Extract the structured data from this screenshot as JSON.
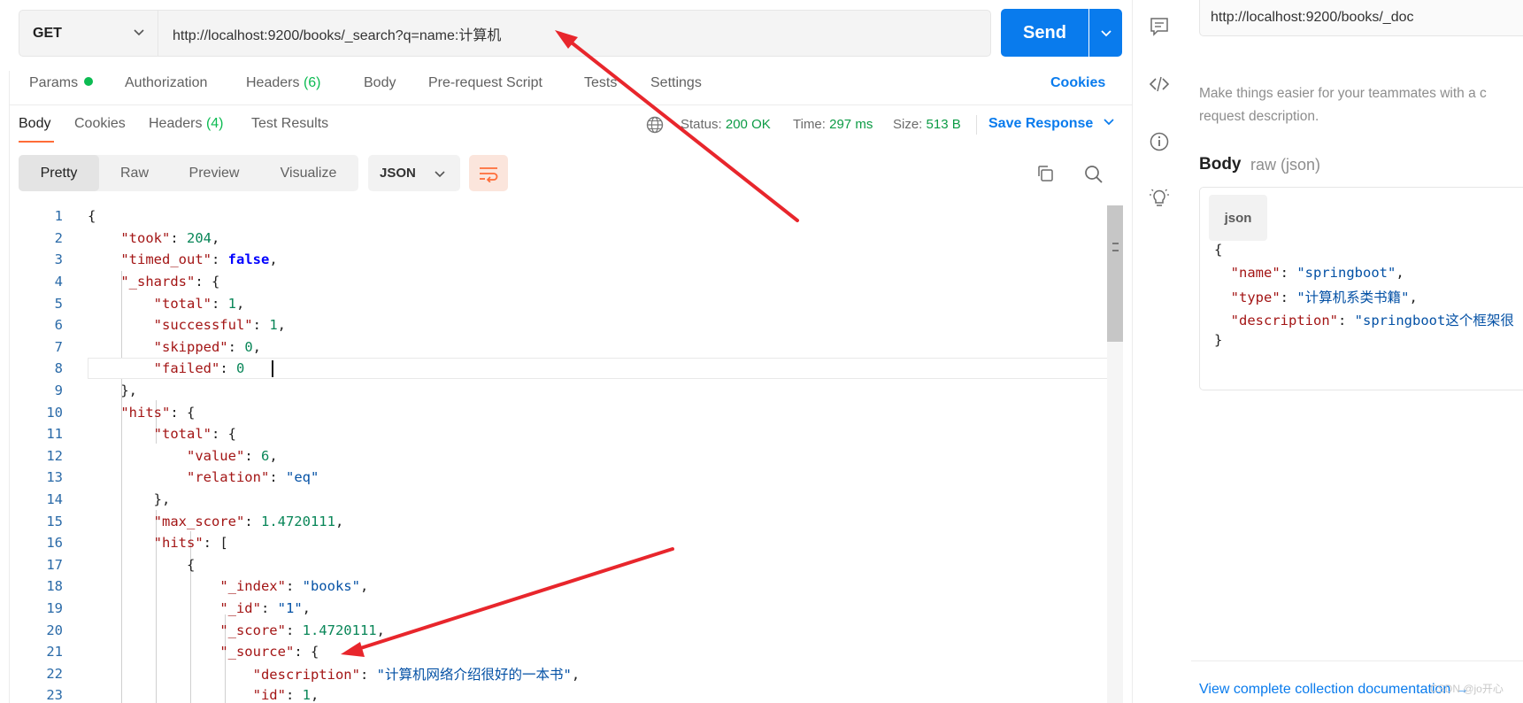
{
  "request": {
    "method": "GET",
    "url": "http://localhost:9200/books/_search?q=name:计算机",
    "send_label": "Send"
  },
  "request_tabs": [
    {
      "label": "Params"
    },
    {
      "label": "Authorization"
    },
    {
      "label": "Headers",
      "count": "(6)"
    },
    {
      "label": "Body"
    },
    {
      "label": "Pre-request Script"
    },
    {
      "label": "Tests"
    },
    {
      "label": "Settings"
    }
  ],
  "cookies_label": "Cookies",
  "response_tabs": [
    {
      "label": "Body"
    },
    {
      "label": "Cookies"
    },
    {
      "label": "Headers",
      "count": "(4)"
    },
    {
      "label": "Test Results"
    }
  ],
  "response_meta": {
    "status_label": "Status:",
    "status_value": "200 OK",
    "time_label": "Time:",
    "time_value": "297 ms",
    "size_label": "Size:",
    "size_value": "513 B",
    "save_label": "Save Response"
  },
  "view_modes": [
    "Pretty",
    "Raw",
    "Preview",
    "Visualize"
  ],
  "format": "JSON",
  "code_lines": [
    {
      "n": "1",
      "t": [
        [
          "p",
          "{"
        ]
      ]
    },
    {
      "n": "2",
      "t": [
        [
          "p",
          "    "
        ],
        [
          "k",
          "\"took\""
        ],
        [
          "p",
          ": "
        ],
        [
          "n",
          "204"
        ],
        [
          "p",
          ","
        ]
      ]
    },
    {
      "n": "3",
      "t": [
        [
          "p",
          "    "
        ],
        [
          "k",
          "\"timed_out\""
        ],
        [
          "p",
          ": "
        ],
        [
          "b",
          "false"
        ],
        [
          "p",
          ","
        ]
      ]
    },
    {
      "n": "4",
      "t": [
        [
          "p",
          "    "
        ],
        [
          "k",
          "\"_shards\""
        ],
        [
          "p",
          ": {"
        ]
      ]
    },
    {
      "n": "5",
      "t": [
        [
          "p",
          "        "
        ],
        [
          "k",
          "\"total\""
        ],
        [
          "p",
          ": "
        ],
        [
          "n",
          "1"
        ],
        [
          "p",
          ","
        ]
      ]
    },
    {
      "n": "6",
      "t": [
        [
          "p",
          "        "
        ],
        [
          "k",
          "\"successful\""
        ],
        [
          "p",
          ": "
        ],
        [
          "n",
          "1"
        ],
        [
          "p",
          ","
        ]
      ]
    },
    {
      "n": "7",
      "t": [
        [
          "p",
          "        "
        ],
        [
          "k",
          "\"skipped\""
        ],
        [
          "p",
          ": "
        ],
        [
          "n",
          "0"
        ],
        [
          "p",
          ","
        ]
      ]
    },
    {
      "n": "8",
      "t": [
        [
          "p",
          "        "
        ],
        [
          "k",
          "\"failed\""
        ],
        [
          "p",
          ": "
        ],
        [
          "n",
          "0"
        ]
      ]
    },
    {
      "n": "9",
      "t": [
        [
          "p",
          "    },"
        ]
      ]
    },
    {
      "n": "10",
      "t": [
        [
          "p",
          "    "
        ],
        [
          "k",
          "\"hits\""
        ],
        [
          "p",
          ": {"
        ]
      ]
    },
    {
      "n": "11",
      "t": [
        [
          "p",
          "        "
        ],
        [
          "k",
          "\"total\""
        ],
        [
          "p",
          ": {"
        ]
      ]
    },
    {
      "n": "12",
      "t": [
        [
          "p",
          "            "
        ],
        [
          "k",
          "\"value\""
        ],
        [
          "p",
          ": "
        ],
        [
          "n",
          "6"
        ],
        [
          "p",
          ","
        ]
      ]
    },
    {
      "n": "13",
      "t": [
        [
          "p",
          "            "
        ],
        [
          "k",
          "\"relation\""
        ],
        [
          "p",
          ": "
        ],
        [
          "s",
          "\"eq\""
        ]
      ]
    },
    {
      "n": "14",
      "t": [
        [
          "p",
          "        },"
        ]
      ]
    },
    {
      "n": "15",
      "t": [
        [
          "p",
          "        "
        ],
        [
          "k",
          "\"max_score\""
        ],
        [
          "p",
          ": "
        ],
        [
          "n",
          "1.4720111"
        ],
        [
          "p",
          ","
        ]
      ]
    },
    {
      "n": "16",
      "t": [
        [
          "p",
          "        "
        ],
        [
          "k",
          "\"hits\""
        ],
        [
          "p",
          ": ["
        ]
      ]
    },
    {
      "n": "17",
      "t": [
        [
          "p",
          "            {"
        ]
      ]
    },
    {
      "n": "18",
      "t": [
        [
          "p",
          "                "
        ],
        [
          "k",
          "\"_index\""
        ],
        [
          "p",
          ": "
        ],
        [
          "s",
          "\"books\""
        ],
        [
          "p",
          ","
        ]
      ]
    },
    {
      "n": "19",
      "t": [
        [
          "p",
          "                "
        ],
        [
          "k",
          "\"_id\""
        ],
        [
          "p",
          ": "
        ],
        [
          "s",
          "\"1\""
        ],
        [
          "p",
          ","
        ]
      ]
    },
    {
      "n": "20",
      "t": [
        [
          "p",
          "                "
        ],
        [
          "k",
          "\"_score\""
        ],
        [
          "p",
          ": "
        ],
        [
          "n",
          "1.4720111"
        ],
        [
          "p",
          ","
        ]
      ]
    },
    {
      "n": "21",
      "t": [
        [
          "p",
          "                "
        ],
        [
          "k",
          "\"_source\""
        ],
        [
          "p",
          ": {"
        ]
      ]
    },
    {
      "n": "22",
      "t": [
        [
          "p",
          "                    "
        ],
        [
          "k",
          "\"description\""
        ],
        [
          "p",
          ": "
        ],
        [
          "s",
          "\"计算机网络介绍很好的一本书\""
        ],
        [
          "p",
          ","
        ]
      ]
    },
    {
      "n": "23",
      "t": [
        [
          "p",
          "                    "
        ],
        [
          "k",
          "\"id\""
        ],
        [
          "p",
          ": "
        ],
        [
          "n",
          "1"
        ],
        [
          "p",
          ","
        ]
      ]
    }
  ],
  "side": {
    "url": "http://localhost:9200/books/_doc",
    "desc_line1": "Make things easier for your teammates with a c",
    "desc_line2": "request description.",
    "body_title": "Body",
    "body_subtitle": "raw (json)",
    "json_tag": "json",
    "json_lines": [
      [
        [
          "p",
          "{"
        ]
      ],
      [
        [
          "p",
          "  "
        ],
        [
          "k",
          "\"name\""
        ],
        [
          "p",
          ": "
        ],
        [
          "s",
          "\"springboot\""
        ],
        [
          "p",
          ","
        ]
      ],
      [
        [
          "p",
          "  "
        ],
        [
          "k",
          "\"type\""
        ],
        [
          "p",
          ": "
        ],
        [
          "s",
          "\"计算机系类书籍\""
        ],
        [
          "p",
          ","
        ]
      ],
      [
        [
          "p",
          "  "
        ],
        [
          "k",
          "\"description\""
        ],
        [
          "p",
          ": "
        ],
        [
          "s",
          "\"springboot这个框架很"
        ]
      ],
      [
        [
          "p",
          "}"
        ]
      ]
    ],
    "footer_link": "View complete collection documentation →",
    "watermark": "CSDN @jo开心"
  },
  "colors": {
    "accent": "#097bed",
    "active_tab_underline": "#ff6c37",
    "status_green": "#0cbb52",
    "annotation_arrow": "#e8262c"
  },
  "icons": [
    "chevron-down-icon",
    "globe-icon",
    "copy-icon",
    "search-icon",
    "wrap-lines-icon",
    "comment-icon",
    "code-icon",
    "info-icon",
    "lightbulb-icon",
    "arrow-annotation"
  ]
}
